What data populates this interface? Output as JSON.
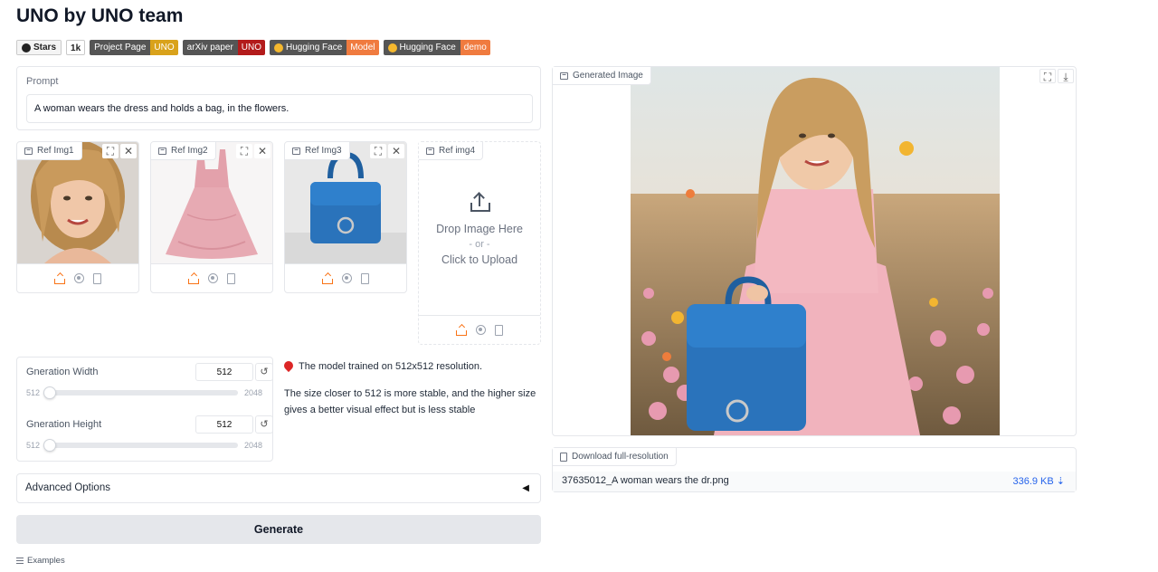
{
  "app": {
    "title": "UNO by UNO team"
  },
  "badges": [
    {
      "left": "Stars",
      "right": "",
      "count": "1k"
    },
    {
      "left": "Project Page",
      "right": "UNO",
      "color": "#d9a21b"
    },
    {
      "left": "arXiv paper",
      "right": "UNO",
      "color": "#b31b1b"
    },
    {
      "left": "Hugging Face",
      "right": "Model",
      "color": "#f07b3f"
    },
    {
      "left": "Hugging Face",
      "right": "demo",
      "color": "#f07b3f"
    }
  ],
  "prompt": {
    "label": "Prompt",
    "value": "A woman wears the dress and holds a bag, in the flowers."
  },
  "refs": [
    {
      "label": "Ref Img1"
    },
    {
      "label": "Ref Img2"
    },
    {
      "label": "Ref Img3"
    },
    {
      "label": "Ref img4",
      "drop": "Drop Image Here",
      "or": "- or -",
      "click": "Click to Upload"
    }
  ],
  "sliders": {
    "width": {
      "label": "Gneration Width",
      "value": "512",
      "min": "512",
      "max": "2048",
      "fraction": 0.0
    },
    "height": {
      "label": "Gneration Height",
      "value": "512",
      "min": "512",
      "max": "2048",
      "fraction": 0.0
    },
    "reset_glyph": "↺"
  },
  "note": {
    "line1": "The model trained on 512x512 resolution.",
    "line2": "The size closer to 512 is more stable, and the higher size gives a better visual effect but is less stable"
  },
  "advanced": {
    "label": "Advanced Options",
    "arrow": "◀"
  },
  "generate": {
    "label": "Generate"
  },
  "examples": {
    "label": "Examples"
  },
  "output": {
    "label": "Generated Image"
  },
  "download": {
    "label": "Download full-resolution",
    "filename": "37635012_A woman wears the dr.png",
    "size": "336.9 KB ⇣"
  },
  "colors": {
    "accent": "#f97316",
    "link": "#2563eb"
  }
}
